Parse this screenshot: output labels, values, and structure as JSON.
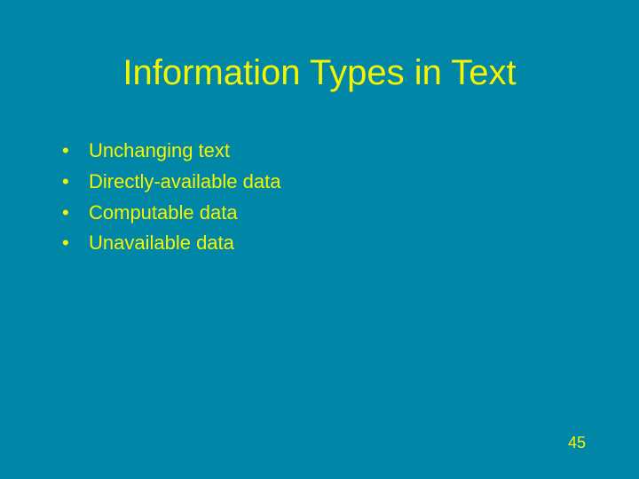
{
  "slide": {
    "title": "Information Types in Text",
    "bullets": [
      "Unchanging text",
      "Directly-available data",
      "Computable data",
      "Unavailable data"
    ],
    "page_number": "45"
  }
}
